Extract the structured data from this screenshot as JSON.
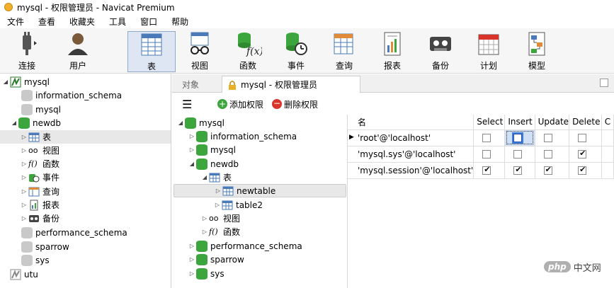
{
  "window": {
    "title": "mysql - 权限管理员 - Navicat Premium"
  },
  "menu": [
    "文件",
    "查看",
    "收藏夹",
    "工具",
    "窗口",
    "帮助"
  ],
  "toolbar": {
    "items": [
      {
        "label": "连接",
        "icon": "plug-icon"
      },
      {
        "label": "用户",
        "icon": "user-icon"
      },
      {
        "label": "表",
        "icon": "table-icon",
        "active": true
      },
      {
        "label": "视图",
        "icon": "view-icon"
      },
      {
        "label": "函数",
        "icon": "function-icon"
      },
      {
        "label": "事件",
        "icon": "event-icon"
      },
      {
        "label": "查询",
        "icon": "query-icon"
      },
      {
        "label": "报表",
        "icon": "report-icon"
      },
      {
        "label": "备份",
        "icon": "backup-icon"
      },
      {
        "label": "计划",
        "icon": "schedule-icon"
      },
      {
        "label": "模型",
        "icon": "model-icon"
      }
    ]
  },
  "left_tree": {
    "connection": "mysql",
    "items": [
      {
        "label": "information_schema"
      },
      {
        "label": "mysql"
      },
      {
        "label": "newdb"
      },
      {
        "label": "表"
      },
      {
        "label": "视图"
      },
      {
        "label": "函数"
      },
      {
        "label": "事件"
      },
      {
        "label": "查询"
      },
      {
        "label": "报表"
      },
      {
        "label": "备份"
      },
      {
        "label": "performance_schema"
      },
      {
        "label": "sparrow"
      },
      {
        "label": "sys"
      },
      {
        "label": "utu"
      }
    ]
  },
  "tabs": {
    "objects": "对象",
    "active": "mysql - 权限管理员"
  },
  "actions": {
    "add": "添加权限",
    "delete": "删除权限"
  },
  "mid_tree": {
    "connection": "mysql",
    "items": [
      {
        "label": "information_schema"
      },
      {
        "label": "mysql"
      },
      {
        "label": "newdb"
      },
      {
        "label": "表"
      },
      {
        "label": "newtable"
      },
      {
        "label": "table2"
      },
      {
        "label": "视图"
      },
      {
        "label": "函数"
      },
      {
        "label": "performance_schema"
      },
      {
        "label": "sparrow"
      },
      {
        "label": "sys"
      }
    ]
  },
  "grid": {
    "columns": [
      "名",
      "Select",
      "Insert",
      "Update",
      "Delete",
      "C"
    ],
    "rows": [
      {
        "name": "'root'@'localhost'",
        "select": false,
        "insert": false,
        "update": false,
        "delete": false
      },
      {
        "name": "'mysql.sys'@'localhost'",
        "select": false,
        "insert": false,
        "update": false,
        "delete": true
      },
      {
        "name": "'mysql.session'@'localhost'",
        "select": true,
        "insert": true,
        "update": true,
        "delete": true
      }
    ]
  },
  "watermark": {
    "text": "php",
    "suffix": "中文网"
  }
}
